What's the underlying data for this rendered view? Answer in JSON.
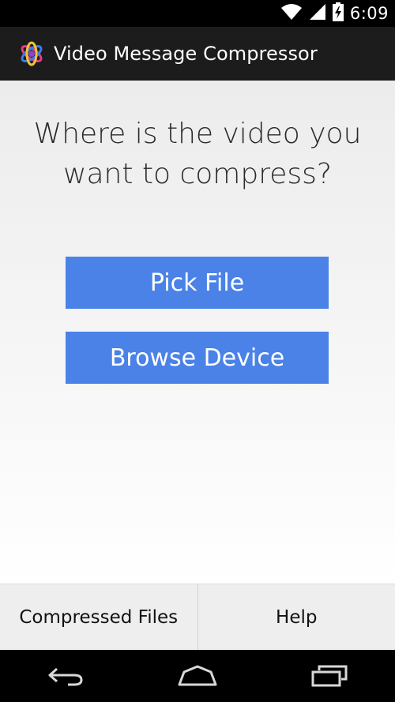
{
  "status_bar": {
    "time": "6:09",
    "icons": [
      "wifi-icon",
      "signal-icon",
      "battery-charging-icon"
    ]
  },
  "action_bar": {
    "app_icon": "app-logo-icon",
    "title": "Video Message Compressor"
  },
  "main": {
    "prompt": "Where is the video you\nwant to compress?",
    "buttons": {
      "pick_file": "Pick File",
      "browse_device": "Browse Device"
    }
  },
  "bottom_tabs": {
    "compressed_files": "Compressed Files",
    "help": "Help"
  },
  "nav_bar": {
    "icons": [
      "back-icon",
      "home-icon",
      "recent-apps-icon"
    ]
  },
  "colors": {
    "button_blue": "#4a82e8",
    "action_bar": "#1c1c1c",
    "status_bar": "#000000"
  }
}
